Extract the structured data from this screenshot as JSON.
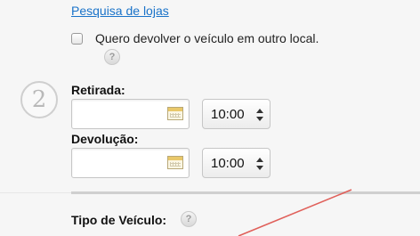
{
  "store_search": {
    "link_text": "Pesquisa de lojas"
  },
  "return_other": {
    "label": "Quero devolver o veículo em outro local.",
    "checked": false,
    "help_icon": "?"
  },
  "step": {
    "number": "2"
  },
  "pickup": {
    "label": "Retirada:",
    "date_value": "",
    "time_value": "10:00",
    "calendar_icon": "calendar-icon"
  },
  "dropoff": {
    "label": "Devolução:",
    "date_value": "",
    "time_value": "10:00",
    "calendar_icon": "calendar-icon"
  },
  "vehicle": {
    "label": "Tipo de Veículo:",
    "help_icon": "?"
  },
  "colors": {
    "link": "#1a73c9",
    "annotation": "#e0605a",
    "divider": "#cfcfcf"
  }
}
